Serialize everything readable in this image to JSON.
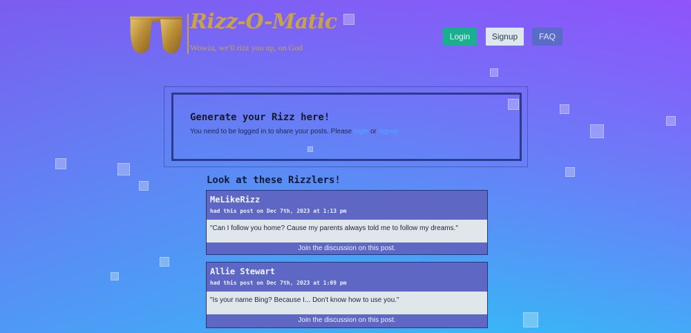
{
  "header": {
    "logo_title": "Rizz-O-Matic",
    "logo_tagline": "Wowza, we'll rizz you up, on God",
    "nav": {
      "login": "Login",
      "signup": "Signup",
      "faq": "FAQ"
    }
  },
  "generate": {
    "title": "Generate your Rizz here!",
    "message_prefix": "You need to be logged in to share your posts. Please",
    "login_link": "login",
    "or_text": "or",
    "signup_link": "signup"
  },
  "feed": {
    "title": "Look at these Rizzlers!",
    "posts": [
      {
        "author": "MeLikeRizz",
        "meta": "had this post on Dec 7th, 2023 at 1:13 pm",
        "body": "\"Can I follow you home? Cause my parents always told me to follow my dreams.\"",
        "join": "Join the discussion on this post."
      },
      {
        "author": "Allie Stewart",
        "meta": "had this post on Dec 7th, 2023 at 1:09 pm",
        "body": "\"Is your name Bing? Because I... Don't know how to use you.\"",
        "join": "Join the discussion on this post."
      }
    ]
  },
  "colors": {
    "accent_login": "#1aaf8f",
    "accent_faq": "#5b6cc8",
    "post_bg": "#5e68c4",
    "logo_gold": "#c9a24a"
  }
}
